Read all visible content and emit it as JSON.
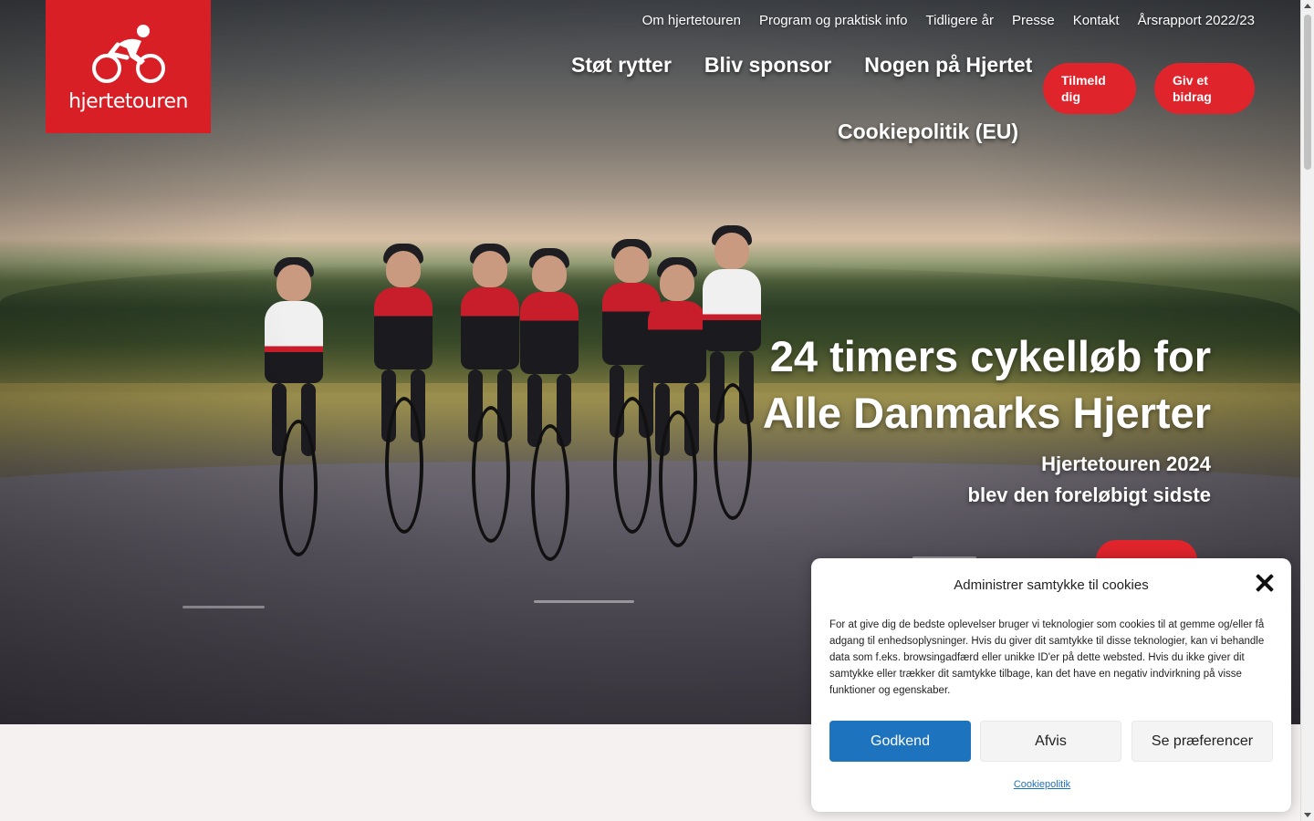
{
  "brand": {
    "name": "hjertetouren",
    "logo_bg": "#d81f26"
  },
  "topnav": {
    "items": [
      "Om hjertetouren",
      "Program og praktisk info",
      "Tidligere år",
      "Presse",
      "Kontakt",
      "Årsrapport 2022/23"
    ]
  },
  "mainnav": {
    "items": [
      "Støt rytter",
      "Bliv sponsor",
      "Nogen på Hjertet"
    ],
    "cookie_policy": "Cookiepolitik (EU)"
  },
  "cta": {
    "signup": "Tilmeld dig",
    "donate": "Giv et bidrag",
    "accent": "#e0242c"
  },
  "hero": {
    "headline_line1": "24 timers cykelløb for",
    "headline_line2": "Alle Danmarks Hjerter",
    "sub_line1": "Hjertetouren 2024",
    "sub_line2": "blev den foreløbigt sidste"
  },
  "cookie_dialog": {
    "title": "Administrer samtykke til cookies",
    "body": "For at give dig de bedste oplevelser bruger vi teknologier som cookies til at gemme og/eller få adgang til enhedsoplysninger. Hvis du giver dit samtykke til disse teknologier, kan vi behandle data som f.eks. browsingadfærd eller unikke ID'er på dette websted. Hvis du ikke giver dit samtykke eller trækker dit samtykke tilbage, kan det have en negativ indvirkning på visse funktioner og egenskaber.",
    "accept": "Godkend",
    "reject": "Afvis",
    "preferences": "Se præferencer",
    "policy_link": "Cookiepolitik",
    "accept_color": "#1e73be"
  }
}
